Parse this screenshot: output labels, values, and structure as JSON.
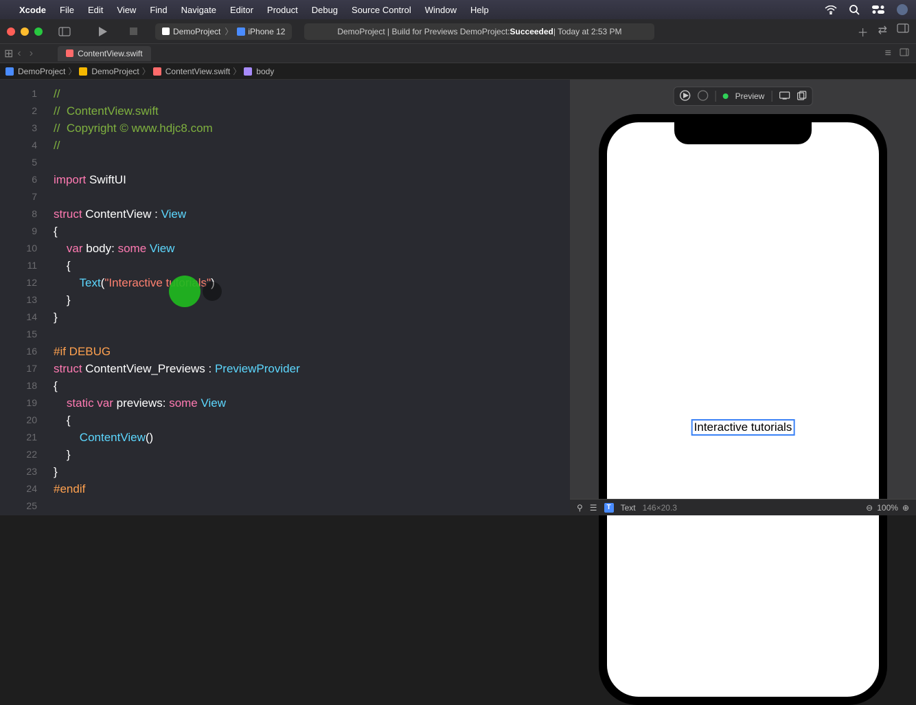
{
  "menubar": {
    "app": "Xcode",
    "items": [
      "File",
      "Edit",
      "View",
      "Find",
      "Navigate",
      "Editor",
      "Product",
      "Debug",
      "Source Control",
      "Window",
      "Help"
    ]
  },
  "scheme": {
    "project": "DemoProject",
    "device": "iPhone 12"
  },
  "status": {
    "prefix": "DemoProject | Build for Previews DemoProject: ",
    "result": "Succeeded",
    "suffix": " | Today at 2:53 PM"
  },
  "tab": {
    "filename": "ContentView.swift"
  },
  "breadcrumb": {
    "items": [
      "DemoProject",
      "DemoProject",
      "ContentView.swift",
      "body"
    ]
  },
  "code": {
    "lines": [
      {
        "n": 1,
        "t": "comment",
        "text": "//"
      },
      {
        "n": 2,
        "t": "comment",
        "text": "//  ContentView.swift"
      },
      {
        "n": 3,
        "t": "comment",
        "text": "//  Copyright © www.hdjc8.com"
      },
      {
        "n": 4,
        "t": "comment",
        "text": "//"
      },
      {
        "n": 5,
        "t": "blank",
        "text": ""
      },
      {
        "n": 6,
        "t": "import",
        "kw": "import",
        "mod": "SwiftUI"
      },
      {
        "n": 7,
        "t": "blank",
        "text": ""
      },
      {
        "n": 8,
        "t": "struct",
        "kw": "struct",
        "name": "ContentView",
        "colon": " : ",
        "type": "View"
      },
      {
        "n": 9,
        "t": "punc",
        "text": "{"
      },
      {
        "n": 10,
        "t": "var",
        "indent": "    ",
        "kw": "var",
        "name": " body: ",
        "some": "some",
        "type": " View"
      },
      {
        "n": 11,
        "t": "punc",
        "text": "    {"
      },
      {
        "n": 12,
        "t": "text",
        "indent": "        ",
        "fn": "Text",
        "open": "(",
        "str": "\"Interactive tutorials\"",
        "close": ")"
      },
      {
        "n": 13,
        "t": "punc",
        "text": "    }"
      },
      {
        "n": 14,
        "t": "punc",
        "text": "}"
      },
      {
        "n": 15,
        "t": "blank",
        "text": ""
      },
      {
        "n": 16,
        "t": "prep",
        "text": "#if DEBUG"
      },
      {
        "n": 17,
        "t": "struct",
        "kw": "struct",
        "name": "ContentView_Previews",
        "colon": " : ",
        "type": "PreviewProvider"
      },
      {
        "n": 18,
        "t": "punc",
        "text": "{"
      },
      {
        "n": 19,
        "t": "var",
        "indent": "    ",
        "kw": "static var",
        "name": " previews: ",
        "some": "some",
        "type": " View"
      },
      {
        "n": 20,
        "t": "punc",
        "text": "    {"
      },
      {
        "n": 21,
        "t": "call",
        "indent": "        ",
        "fn": "ContentView",
        "args": "()"
      },
      {
        "n": 22,
        "t": "punc",
        "text": "    }"
      },
      {
        "n": 23,
        "t": "punc",
        "text": "}"
      },
      {
        "n": 24,
        "t": "prep",
        "text": "#endif"
      },
      {
        "n": 25,
        "t": "blank",
        "text": ""
      }
    ]
  },
  "preview": {
    "toolbar_label": "Preview",
    "text": "Interactive tutorials",
    "bottom_label": "Text",
    "bottom_size": "146×20.3",
    "zoom": "100%"
  }
}
